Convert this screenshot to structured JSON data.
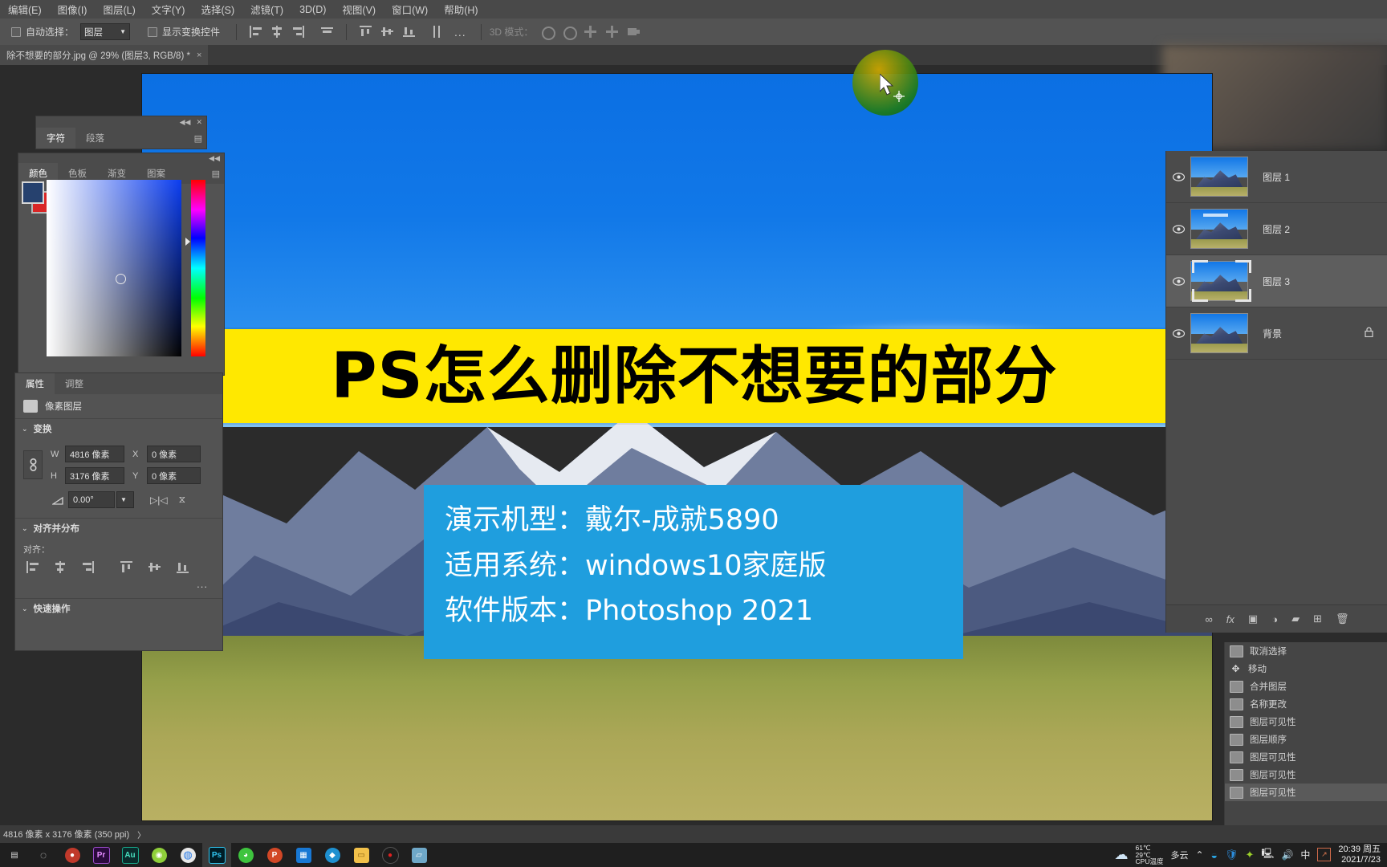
{
  "menubar": {
    "items": [
      {
        "label": "编辑(E)"
      },
      {
        "label": "图像(I)"
      },
      {
        "label": "图层(L)"
      },
      {
        "label": "文字(Y)"
      },
      {
        "label": "选择(S)"
      },
      {
        "label": "滤镜(T)"
      },
      {
        "label": "3D(D)"
      },
      {
        "label": "视图(V)"
      },
      {
        "label": "窗口(W)"
      },
      {
        "label": "帮助(H)"
      }
    ]
  },
  "optionsbar": {
    "auto_select_label": "自动选择：",
    "auto_select_value": "图层",
    "show_transform_label": "显示变换控件",
    "more_label": "...",
    "mode_3d_label": "3D 模式："
  },
  "doctab": {
    "title": "除不想要的部分.jpg @ 29% (图层3, RGB/8) *",
    "close": "×"
  },
  "overlay": {
    "title": "PS怎么删除不想要的部分",
    "info_lines": [
      "演示机型：戴尔-成就5890",
      "适用系统：windows10家庭版",
      "软件版本：Photoshop 2021"
    ],
    "title_bg": "#ffe800",
    "info_bg": "#1f9ede"
  },
  "character_panel": {
    "tabs": [
      {
        "label": "字符",
        "active": true
      },
      {
        "label": "段落",
        "active": false
      }
    ],
    "collapse": "◀◀",
    "close": "✕",
    "menu": "▤"
  },
  "color_panel": {
    "tabs": [
      {
        "label": "颜色",
        "active": true
      },
      {
        "label": "色板",
        "active": false
      },
      {
        "label": "渐变",
        "active": false
      },
      {
        "label": "图案",
        "active": false
      }
    ],
    "collapse": "◀◀",
    "close": "✕",
    "foreground_color": "#26416e",
    "background_color": "#d92626"
  },
  "properties_panel": {
    "tabs": [
      {
        "label": "属性",
        "active": true
      },
      {
        "label": "调整",
        "active": false
      }
    ],
    "layer_kind": "像素图层",
    "sections": {
      "transform": {
        "title": "变换",
        "w_label": "W",
        "w_value": "4816 像素",
        "x_label": "X",
        "x_value": "0 像素",
        "h_label": "H",
        "h_value": "3176 像素",
        "y_label": "Y",
        "y_value": "0 像素",
        "angle_value": "0.00°",
        "link_icon": "⛓"
      },
      "align": {
        "title": "对齐并分布",
        "align_label": "对齐：",
        "more": "..."
      },
      "quick": {
        "title": "快速操作"
      }
    }
  },
  "layers_panel": {
    "rows": [
      {
        "name": "图层 1",
        "visible": true,
        "selected": false,
        "locked": false
      },
      {
        "name": "图层 2",
        "visible": true,
        "selected": false,
        "locked": false
      },
      {
        "name": "图层 3",
        "visible": true,
        "selected": true,
        "locked": false
      },
      {
        "name": "背景",
        "visible": true,
        "selected": false,
        "locked": true
      }
    ],
    "lock_glyph": "🔒",
    "footer_icons": [
      "link-icon",
      "fx-icon",
      "mask-icon",
      "adjustment-icon",
      "group-icon",
      "new-layer-icon",
      "delete-icon"
    ],
    "footer_glyphs": [
      "∞",
      "fx",
      "▣",
      "◑",
      "▰",
      "⊞",
      "🗑"
    ]
  },
  "history_panel": {
    "rows": [
      {
        "label": "取消选择",
        "icon": "snapshot-icon",
        "current": false
      },
      {
        "label": "移动",
        "icon": "move-icon",
        "current": false
      },
      {
        "label": "合并图层",
        "icon": "snapshot-icon",
        "current": false
      },
      {
        "label": "名称更改",
        "icon": "snapshot-icon",
        "current": false
      },
      {
        "label": "图层可见性",
        "icon": "snapshot-icon",
        "current": false
      },
      {
        "label": "图层顺序",
        "icon": "snapshot-icon",
        "current": false
      },
      {
        "label": "图层可见性",
        "icon": "snapshot-icon",
        "current": false
      },
      {
        "label": "图层可见性",
        "icon": "snapshot-icon",
        "current": false
      },
      {
        "label": "图层可见性",
        "icon": "snapshot-icon",
        "current": true
      }
    ]
  },
  "statusbar": {
    "text": "4816 像素 x 3176 像素 (350 ppi)",
    "arrow": "〉"
  },
  "taskbar": {
    "items": [
      {
        "name": "task-view",
        "glyph": "▤",
        "color": "transparent",
        "text": "#d8d8d8",
        "active": false
      },
      {
        "name": "search",
        "glyph": "◌",
        "color": "transparent",
        "text": "#d8d8d8",
        "active": false
      },
      {
        "name": "app-red",
        "glyph": "●",
        "color": "#c0392b",
        "text": "#ffffff",
        "active": false
      },
      {
        "name": "premiere",
        "glyph": "Pr",
        "color": "#2a0a3d",
        "text": "#e48cff",
        "active": false
      },
      {
        "name": "audition",
        "glyph": "Au",
        "color": "#0a2b2b",
        "text": "#4ae0c0",
        "active": false
      },
      {
        "name": "app-green",
        "glyph": "◉",
        "color": "#8fcf3a",
        "text": "#ffffff",
        "active": false
      },
      {
        "name": "chrome",
        "glyph": "◍",
        "color": "#e8e8e8",
        "text": "#2b7de9",
        "active": false
      },
      {
        "name": "photoshop",
        "glyph": "Ps",
        "color": "#001d26",
        "text": "#31c5f0",
        "active": true
      },
      {
        "name": "wechat",
        "glyph": "◕",
        "color": "#3ec43e",
        "text": "#ffffff",
        "active": false
      },
      {
        "name": "powerpoint",
        "glyph": "P",
        "color": "#d24726",
        "text": "#ffffff",
        "active": false
      },
      {
        "name": "app-blue-grid",
        "glyph": "▦",
        "color": "#1878d4",
        "text": "#ffffff",
        "active": false
      },
      {
        "name": "app-cyan",
        "glyph": "◆",
        "color": "#1e90d0",
        "text": "#ffffff",
        "active": false
      },
      {
        "name": "file-explorer",
        "glyph": "▭",
        "color": "#f2c14a",
        "text": "#8a6010",
        "active": false
      },
      {
        "name": "recorder",
        "glyph": "●",
        "color": "#1c1c1c",
        "text": "#e02020",
        "active": false
      },
      {
        "name": "app-paper",
        "glyph": "▱",
        "color": "#6fa8c8",
        "text": "#ffffff",
        "active": false
      }
    ],
    "tray": {
      "weather_high": "61℃",
      "weather_low": "29℃",
      "cpu_label": "CPU温度",
      "weather_text": "多云",
      "chevron": "⌃",
      "icons": [
        {
          "name": "app-tray-blue",
          "glyph": "◒",
          "color": "#2aa3e0"
        },
        {
          "name": "shield-icon",
          "glyph": "🛡",
          "color": "#2b8ad8"
        },
        {
          "name": "app-tray-green",
          "glyph": "✦",
          "color": "#9bd02a"
        },
        {
          "name": "network-icon",
          "glyph": "🖳",
          "color": "#d8d8d8"
        },
        {
          "name": "volume-icon",
          "glyph": "🔊",
          "color": "#d8d8d8"
        }
      ],
      "ime_label": "中",
      "ime_box_glyph": "↗",
      "time": "20:39 周五",
      "date": "2021/7/23"
    }
  }
}
